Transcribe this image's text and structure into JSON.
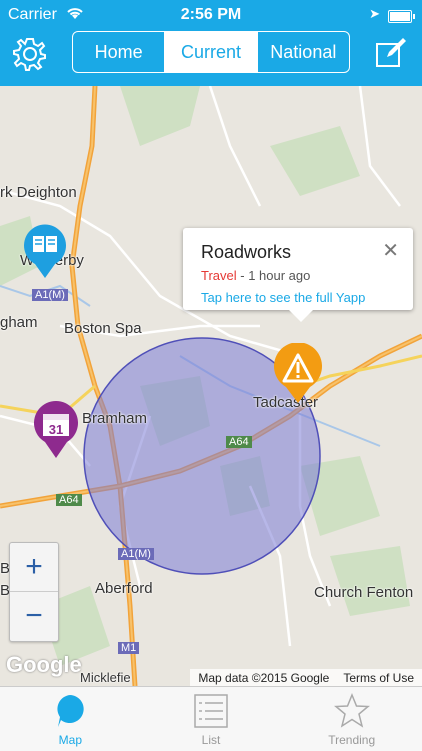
{
  "status_bar": {
    "carrier": "Carrier",
    "time": "2:56 PM"
  },
  "nav": {
    "segments": [
      "Home",
      "Current",
      "National"
    ],
    "active_segment": "Current"
  },
  "map": {
    "places": {
      "kirk_deighton": "rk Deighton",
      "wetherby": "Wetherby",
      "ngham": "gham",
      "boston_spa": "Boston Spa",
      "bramham": "Bramham",
      "tadcaster": "Tadcaster",
      "aberford": "Aberford",
      "church_fenton": "Church Fenton",
      "b_left": "B",
      "b_left2": "B",
      "micklefield": "Micklefie"
    },
    "roads": {
      "a1m_top": "A1(M)",
      "a1m_bottom": "A1(M)",
      "a64_left": "A64",
      "a64_mid": "A64",
      "m1": "M1"
    },
    "zoom": {
      "in": "+",
      "out": "−"
    },
    "google_logo": "Google",
    "attribution": {
      "data": "Map data ©2015 Google",
      "terms": "Terms of Use"
    },
    "pins": {
      "calendar_day": "31"
    }
  },
  "callout": {
    "title": "Roadworks",
    "category": "Travel",
    "separator": " - ",
    "time": "1 hour ago",
    "link": "Tap here to see the full Yapp",
    "close": "✕"
  },
  "tabs": [
    {
      "label": "Map",
      "icon": "speech-bubble-icon",
      "active": true
    },
    {
      "label": "List",
      "icon": "list-icon",
      "active": false
    },
    {
      "label": "Trending",
      "icon": "star-icon",
      "active": false
    }
  ],
  "colors": {
    "accent": "#1aa9e6",
    "alert_pin": "#f39c12",
    "event_pin": "#8e2a8e",
    "news_pin": "#1e9fe0",
    "radius_fill": "#7b7bd6"
  }
}
